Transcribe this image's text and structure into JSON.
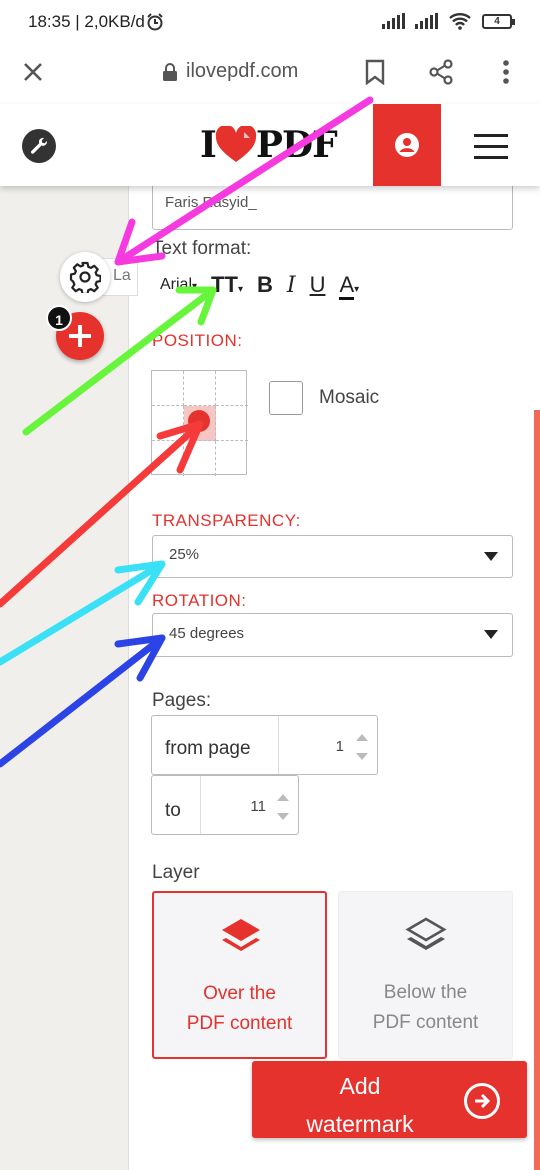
{
  "status_bar": {
    "time": "18:35 | 2,0KB/d",
    "battery": "4"
  },
  "browser": {
    "url": "ilovepdf.com"
  },
  "site_header": {
    "logo_left": "I",
    "logo_right": "PDF"
  },
  "side_panel": {
    "badge_count": "1",
    "tab_label": "La"
  },
  "form": {
    "text_value": "Faris Rasyid_",
    "text_format_label": "Text format:",
    "font_name": "Arial",
    "size_label": "TT",
    "bold": "B",
    "italic": "I",
    "underline": "U",
    "color": "A",
    "position_label": "POSITION:",
    "mosaic_label": "Mosaic",
    "transparency_label": "TRANSPARENCY:",
    "transparency_value": "25%",
    "rotation_label": "ROTATION:",
    "rotation_value": "45 degrees",
    "pages_label": "Pages:",
    "from_label": "from page",
    "from_value": "1",
    "to_label": "to",
    "to_value": "11",
    "layer_label": "Layer",
    "layer_over_line1": "Over the",
    "layer_over_line2": "PDF content",
    "layer_below_line1": "Below the",
    "layer_below_line2": "PDF content"
  },
  "submit": {
    "line1": "Add",
    "line2": "watermark"
  },
  "colors": {
    "brand_red": "#e5322d"
  },
  "annotations": [
    {
      "color": "#f53ae0",
      "points_to": "gear-icon"
    },
    {
      "color": "#66f53a",
      "points_to": "text-size-button"
    },
    {
      "color": "#f53a3a",
      "points_to": "position-grid"
    },
    {
      "color": "#3ae0f5",
      "points_to": "transparency-select"
    },
    {
      "color": "#2c44e6",
      "points_to": "rotation-select"
    }
  ]
}
